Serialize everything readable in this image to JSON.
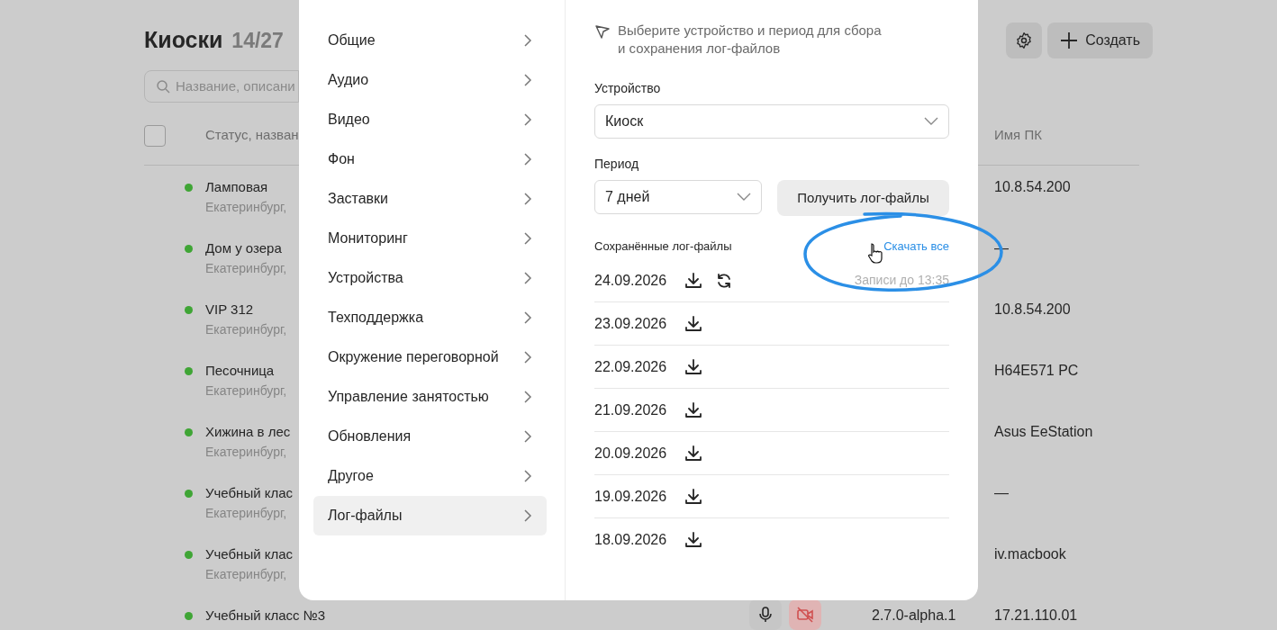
{
  "page": {
    "title": "Киоски",
    "count": "14/27",
    "search": {
      "placeholder": "Название, описани"
    },
    "create_button": {
      "label": "Создать"
    }
  },
  "table": {
    "select_all": {
      "checked": false
    },
    "columns": [
      "Статус, назван",
      "Имя ПК"
    ],
    "rows": [
      {
        "name": "Ламповая",
        "location": "Екатеринбург,",
        "online": true,
        "pc_name": "10.8.54.200"
      },
      {
        "name": "Дом у озера",
        "location": "Екатеринбург,",
        "online": true,
        "pc_name": "—"
      },
      {
        "name": "VIP 312",
        "location": "Екатеринбург,",
        "online": true,
        "pc_name": "10.8.54.200"
      },
      {
        "name": "Песочница",
        "location": "Екатеринбург,",
        "online": true,
        "pc_name": "H64E571 PC"
      },
      {
        "name": "Хижина в лес",
        "location": "Екатеринбург,",
        "online": true,
        "pc_name": "Asus EeStation"
      },
      {
        "name": "Учебный клас",
        "location": "Екатеринбург,",
        "online": true,
        "pc_name": "—"
      },
      {
        "name": "Учебный клас",
        "location": "Екатеринбург,",
        "online": true,
        "pc_name": "iv.macbook"
      },
      {
        "name": "Учебный класс №3",
        "online": true,
        "media": [
          {
            "kind": "mic",
            "on": true
          },
          {
            "kind": "camera",
            "on": false
          }
        ],
        "version": "2.7.0-alpha.1",
        "pc_name": "17.21.110.01"
      }
    ]
  },
  "modal": {
    "nav": [
      {
        "label": "Общие",
        "selected": false
      },
      {
        "label": "Аудио",
        "selected": false
      },
      {
        "label": "Видео",
        "selected": false
      },
      {
        "label": "Фон",
        "selected": false
      },
      {
        "label": "Заставки",
        "selected": false
      },
      {
        "label": "Мониторинг",
        "selected": false
      },
      {
        "label": "Устройства",
        "selected": false
      },
      {
        "label": "Техподдержка",
        "selected": false
      },
      {
        "label": "Окружение переговорной",
        "selected": false
      },
      {
        "label": "Управление занятостью",
        "selected": false
      },
      {
        "label": "Обновления",
        "selected": false
      },
      {
        "label": "Другое",
        "selected": false
      },
      {
        "label": "Лог-файлы",
        "selected": true
      }
    ],
    "hint": "Выберите устройство и период для сбора и сохранения лог-файлов",
    "device": {
      "label": "Устройство",
      "value": "Киоск"
    },
    "period": {
      "label": "Период",
      "value": "7 дней"
    },
    "fetch_button": "Получить лог-файлы",
    "saved": {
      "title": "Сохранённые лог-файлы",
      "download_all": "Скачать все",
      "files": [
        {
          "date": "24.09.2026",
          "refreshable": true,
          "note": "Записи до 13:35"
        },
        {
          "date": "23.09.2026",
          "refreshable": false
        },
        {
          "date": "22.09.2026",
          "refreshable": false
        },
        {
          "date": "21.09.2026",
          "refreshable": false
        },
        {
          "date": "20.09.2026",
          "refreshable": false
        },
        {
          "date": "19.09.2026",
          "refreshable": false
        },
        {
          "date": "18.09.2026",
          "refreshable": false
        }
      ]
    }
  }
}
